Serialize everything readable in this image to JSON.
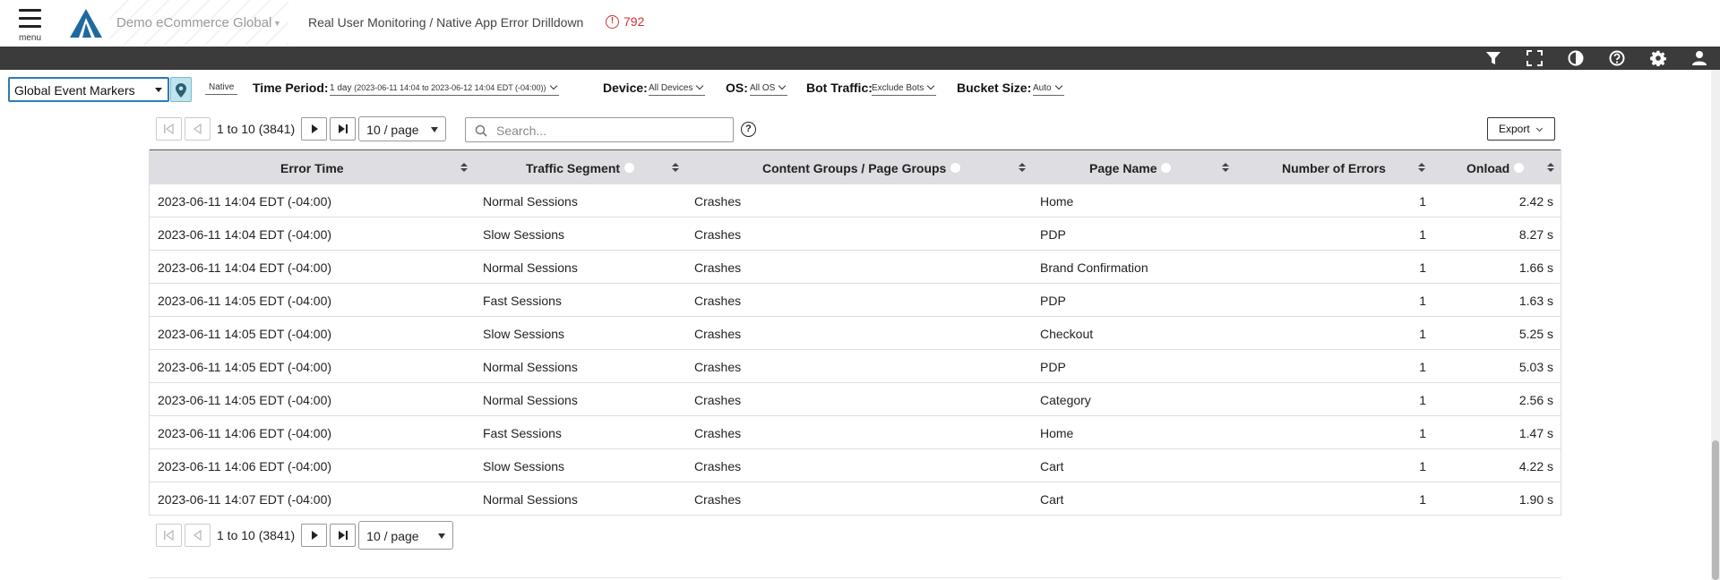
{
  "header": {
    "menu_label": "menu",
    "brand_name": "Demo eCommerce Global",
    "breadcrumb": "Real User Monitoring / Native App Error Drilldown",
    "error_count": "792",
    "error_icon_glyph": "!"
  },
  "toolbar": {
    "icons": [
      "filter-icon",
      "fullscreen-icon",
      "contrast-icon",
      "help-icon",
      "gear-icon",
      "user-icon"
    ]
  },
  "filters": {
    "event_markers": "Global Event Markers",
    "platform": "Native",
    "time_period_label": "Time Period:",
    "time_period_value": "1 day",
    "time_period_range": "(2023-06-11 14:04 to 2023-06-12 14:04 EDT (-04:00))",
    "device_label": "Device:",
    "device_value": "All Devices",
    "os_label": "OS:",
    "os_value": "All OS",
    "bot_label": "Bot Traffic:",
    "bot_value": "Exclude Bots",
    "bucket_label": "Bucket Size:",
    "bucket_value": "Auto"
  },
  "pager": {
    "info": "1 to 10 (3841)",
    "page_size": "10 / page",
    "search_placeholder": "Search...",
    "help_glyph": "?",
    "export_label": "Export"
  },
  "table": {
    "columns": [
      "Error Time",
      "Traffic Segment",
      "Content Groups / Page Groups",
      "Page Name",
      "Number of Errors",
      "Onload"
    ],
    "rows": [
      {
        "time": "2023-06-11 14:04 EDT (-04:00)",
        "segment": "Normal Sessions",
        "group": "Crashes",
        "page": "Home",
        "errors": "1",
        "onload": "2.42 s"
      },
      {
        "time": "2023-06-11 14:04 EDT (-04:00)",
        "segment": "Slow Sessions",
        "group": "Crashes",
        "page": "PDP",
        "errors": "1",
        "onload": "8.27 s"
      },
      {
        "time": "2023-06-11 14:04 EDT (-04:00)",
        "segment": "Normal Sessions",
        "group": "Crashes",
        "page": "Brand Confirmation",
        "errors": "1",
        "onload": "1.66 s"
      },
      {
        "time": "2023-06-11 14:05 EDT (-04:00)",
        "segment": "Fast Sessions",
        "group": "Crashes",
        "page": "PDP",
        "errors": "1",
        "onload": "1.63 s"
      },
      {
        "time": "2023-06-11 14:05 EDT (-04:00)",
        "segment": "Slow Sessions",
        "group": "Crashes",
        "page": "Checkout",
        "errors": "1",
        "onload": "5.25 s"
      },
      {
        "time": "2023-06-11 14:05 EDT (-04:00)",
        "segment": "Normal Sessions",
        "group": "Crashes",
        "page": "PDP",
        "errors": "1",
        "onload": "5.03 s"
      },
      {
        "time": "2023-06-11 14:05 EDT (-04:00)",
        "segment": "Normal Sessions",
        "group": "Crashes",
        "page": "Category",
        "errors": "1",
        "onload": "2.56 s"
      },
      {
        "time": "2023-06-11 14:06 EDT (-04:00)",
        "segment": "Fast Sessions",
        "group": "Crashes",
        "page": "Home",
        "errors": "1",
        "onload": "1.47 s"
      },
      {
        "time": "2023-06-11 14:06 EDT (-04:00)",
        "segment": "Slow Sessions",
        "group": "Crashes",
        "page": "Cart",
        "errors": "1",
        "onload": "4.22 s"
      },
      {
        "time": "2023-06-11 14:07 EDT (-04:00)",
        "segment": "Normal Sessions",
        "group": "Crashes",
        "page": "Cart",
        "errors": "1",
        "onload": "1.90 s"
      }
    ]
  },
  "colors": {
    "toolbar_bg": "#3b3b3b",
    "accent_blue": "#2b7cb6",
    "error_red": "#d32f2f",
    "header_row_bg": "#dddde2",
    "logo_blue": "#1e6aa0"
  }
}
